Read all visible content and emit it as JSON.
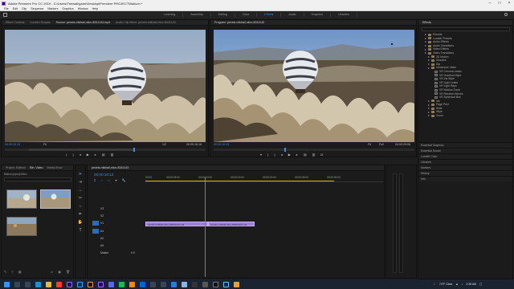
{
  "window": {
    "title": "Adobe Premiere Pro CC 2019 - C:\\Users\\Thewall\\gamr\\Desktop\\Premiere PROJECT\\Balloon *"
  },
  "menu": [
    "File",
    "Edit",
    "Clip",
    "Sequence",
    "Markers",
    "Graphics",
    "Window",
    "Help"
  ],
  "workspaces": [
    "Learning",
    "Assembly",
    "Editing",
    "Color",
    "Effects",
    "Audio",
    "Graphics",
    "Libraries"
  ],
  "active_workspace": "Effects",
  "source_panel": {
    "tabs": [
      "Effect Controls",
      "Lumetri Scopes",
      "Source: pexels-mikhail-nilov-8341143.mp4",
      "Audio Clip Mixer: pexels-mikhail-nilov-8341143"
    ],
    "timecode": "00:00:10:15",
    "fit": "Fit",
    "duration": "00:00:16:18",
    "resolution": "1/2"
  },
  "program_panel": {
    "title": "Program: pexels-mikhail-nilov-8341143",
    "timecode": "00:00:10:15",
    "fit": "Fit",
    "duration": "00:00:29:06",
    "resolution": "Full"
  },
  "project_panel": {
    "tabs": [
      "Project: Balloon",
      "Bin: Video",
      "Media Brow"
    ],
    "path": "Balloon.prproj\\Video",
    "search_placeholder": "",
    "clips": [
      {
        "name": "pexels-mikhail...",
        "dur": "16:18"
      },
      {
        "name": "pexels-mikhail...",
        "dur": "12:13"
      },
      {
        "name": "pexels-mikhail...",
        "dur": "15:20"
      }
    ]
  },
  "timeline": {
    "sequence_tab": "pexels-mikhail-nilov-8341143",
    "timecode": "00:00:10:12",
    "ruler": [
      "00:00",
      "00:00:05:00",
      "00:00:10:00",
      "00:00:15:00",
      "00:00:20:00",
      "00:00:25:00",
      "00:00:30:00"
    ],
    "video_tracks": [
      "V3",
      "V2",
      "V1"
    ],
    "audio_tracks": [
      "A1",
      "A2",
      "A3"
    ],
    "master": "Master",
    "master_value": "0.0",
    "clip1": "pexels-mikhail-nilov-8341143.mp4",
    "clip2": "pexels-mikhail-nilov-8341143.mp4"
  },
  "effects_panel": {
    "title": "Effects",
    "items": [
      {
        "label": "Presets",
        "indent": 1,
        "kind": "folder"
      },
      {
        "label": "Lumetri Presets",
        "indent": 1,
        "kind": "folder"
      },
      {
        "label": "Audio Effects",
        "indent": 1,
        "kind": "folder"
      },
      {
        "label": "Audio Transitions",
        "indent": 1,
        "kind": "folder"
      },
      {
        "label": "Video Effects",
        "indent": 1,
        "kind": "folder"
      },
      {
        "label": "Video Transitions",
        "indent": 1,
        "kind": "folder"
      },
      {
        "label": "3D Motion",
        "indent": 2,
        "kind": "folder"
      },
      {
        "label": "Dissolve",
        "indent": 2,
        "kind": "folder"
      },
      {
        "label": "Dip",
        "indent": 2,
        "kind": "folder"
      },
      {
        "label": "Immersive Video",
        "indent": 2,
        "kind": "folder"
      },
      {
        "label": "VR Chroma Leaks",
        "indent": 3,
        "kind": "fx"
      },
      {
        "label": "VR Gradient Wipe",
        "indent": 3,
        "kind": "fx"
      },
      {
        "label": "VR Iris Wipe",
        "indent": 3,
        "kind": "fx"
      },
      {
        "label": "VR Light Leaks",
        "indent": 3,
        "kind": "fx"
      },
      {
        "label": "VR Light Rays",
        "indent": 3,
        "kind": "fx"
      },
      {
        "label": "VR Mobius Zoom",
        "indent": 3,
        "kind": "fx"
      },
      {
        "label": "VR Random Blocks",
        "indent": 3,
        "kind": "fx"
      },
      {
        "label": "VR Spherical Blur",
        "indent": 3,
        "kind": "fx"
      },
      {
        "label": "Iris",
        "indent": 2,
        "kind": "folder"
      },
      {
        "label": "Page Peel",
        "indent": 2,
        "kind": "folder"
      },
      {
        "label": "Slide",
        "indent": 2,
        "kind": "folder"
      },
      {
        "label": "Wipe",
        "indent": 2,
        "kind": "folder"
      },
      {
        "label": "Zoom",
        "indent": 2,
        "kind": "folder"
      }
    ]
  },
  "side_panels": [
    "Essential Graphics",
    "Essential Sound",
    "Lumetri Color",
    "Libraries",
    "Markers",
    "History",
    "Info"
  ],
  "taskbar": {
    "weather": "74°F Clear",
    "time": "2:38 AM",
    "date": "4/8/2022"
  }
}
